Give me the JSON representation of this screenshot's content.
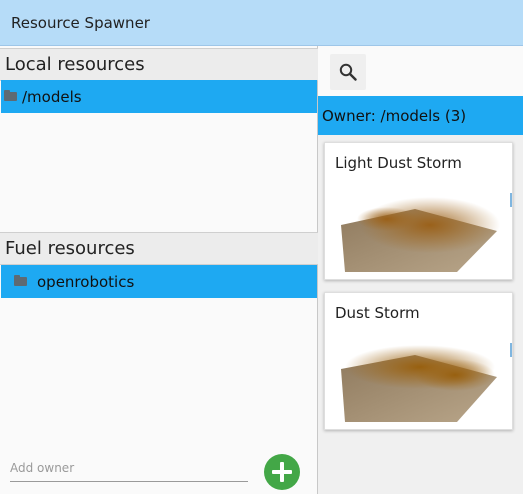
{
  "window": {
    "title": "Resource Spawner"
  },
  "local": {
    "header": "Local resources",
    "items": [
      {
        "label": "/models",
        "icon": "folder-icon"
      }
    ]
  },
  "fuel": {
    "header": "Fuel resources",
    "items": [
      {
        "label": "openrobotics",
        "icon": "folder-icon"
      }
    ]
  },
  "add_owner": {
    "placeholder": "Add owner",
    "value": ""
  },
  "search": {
    "icon": "search-icon"
  },
  "owner": {
    "label": "Owner: /models (3)"
  },
  "cards": [
    {
      "title": "Light Dust Storm"
    },
    {
      "title": "Dust Storm"
    }
  ],
  "colors": {
    "titlebar": "#b6dcf8",
    "selection": "#1ea9f2",
    "add_button": "#43a747"
  }
}
